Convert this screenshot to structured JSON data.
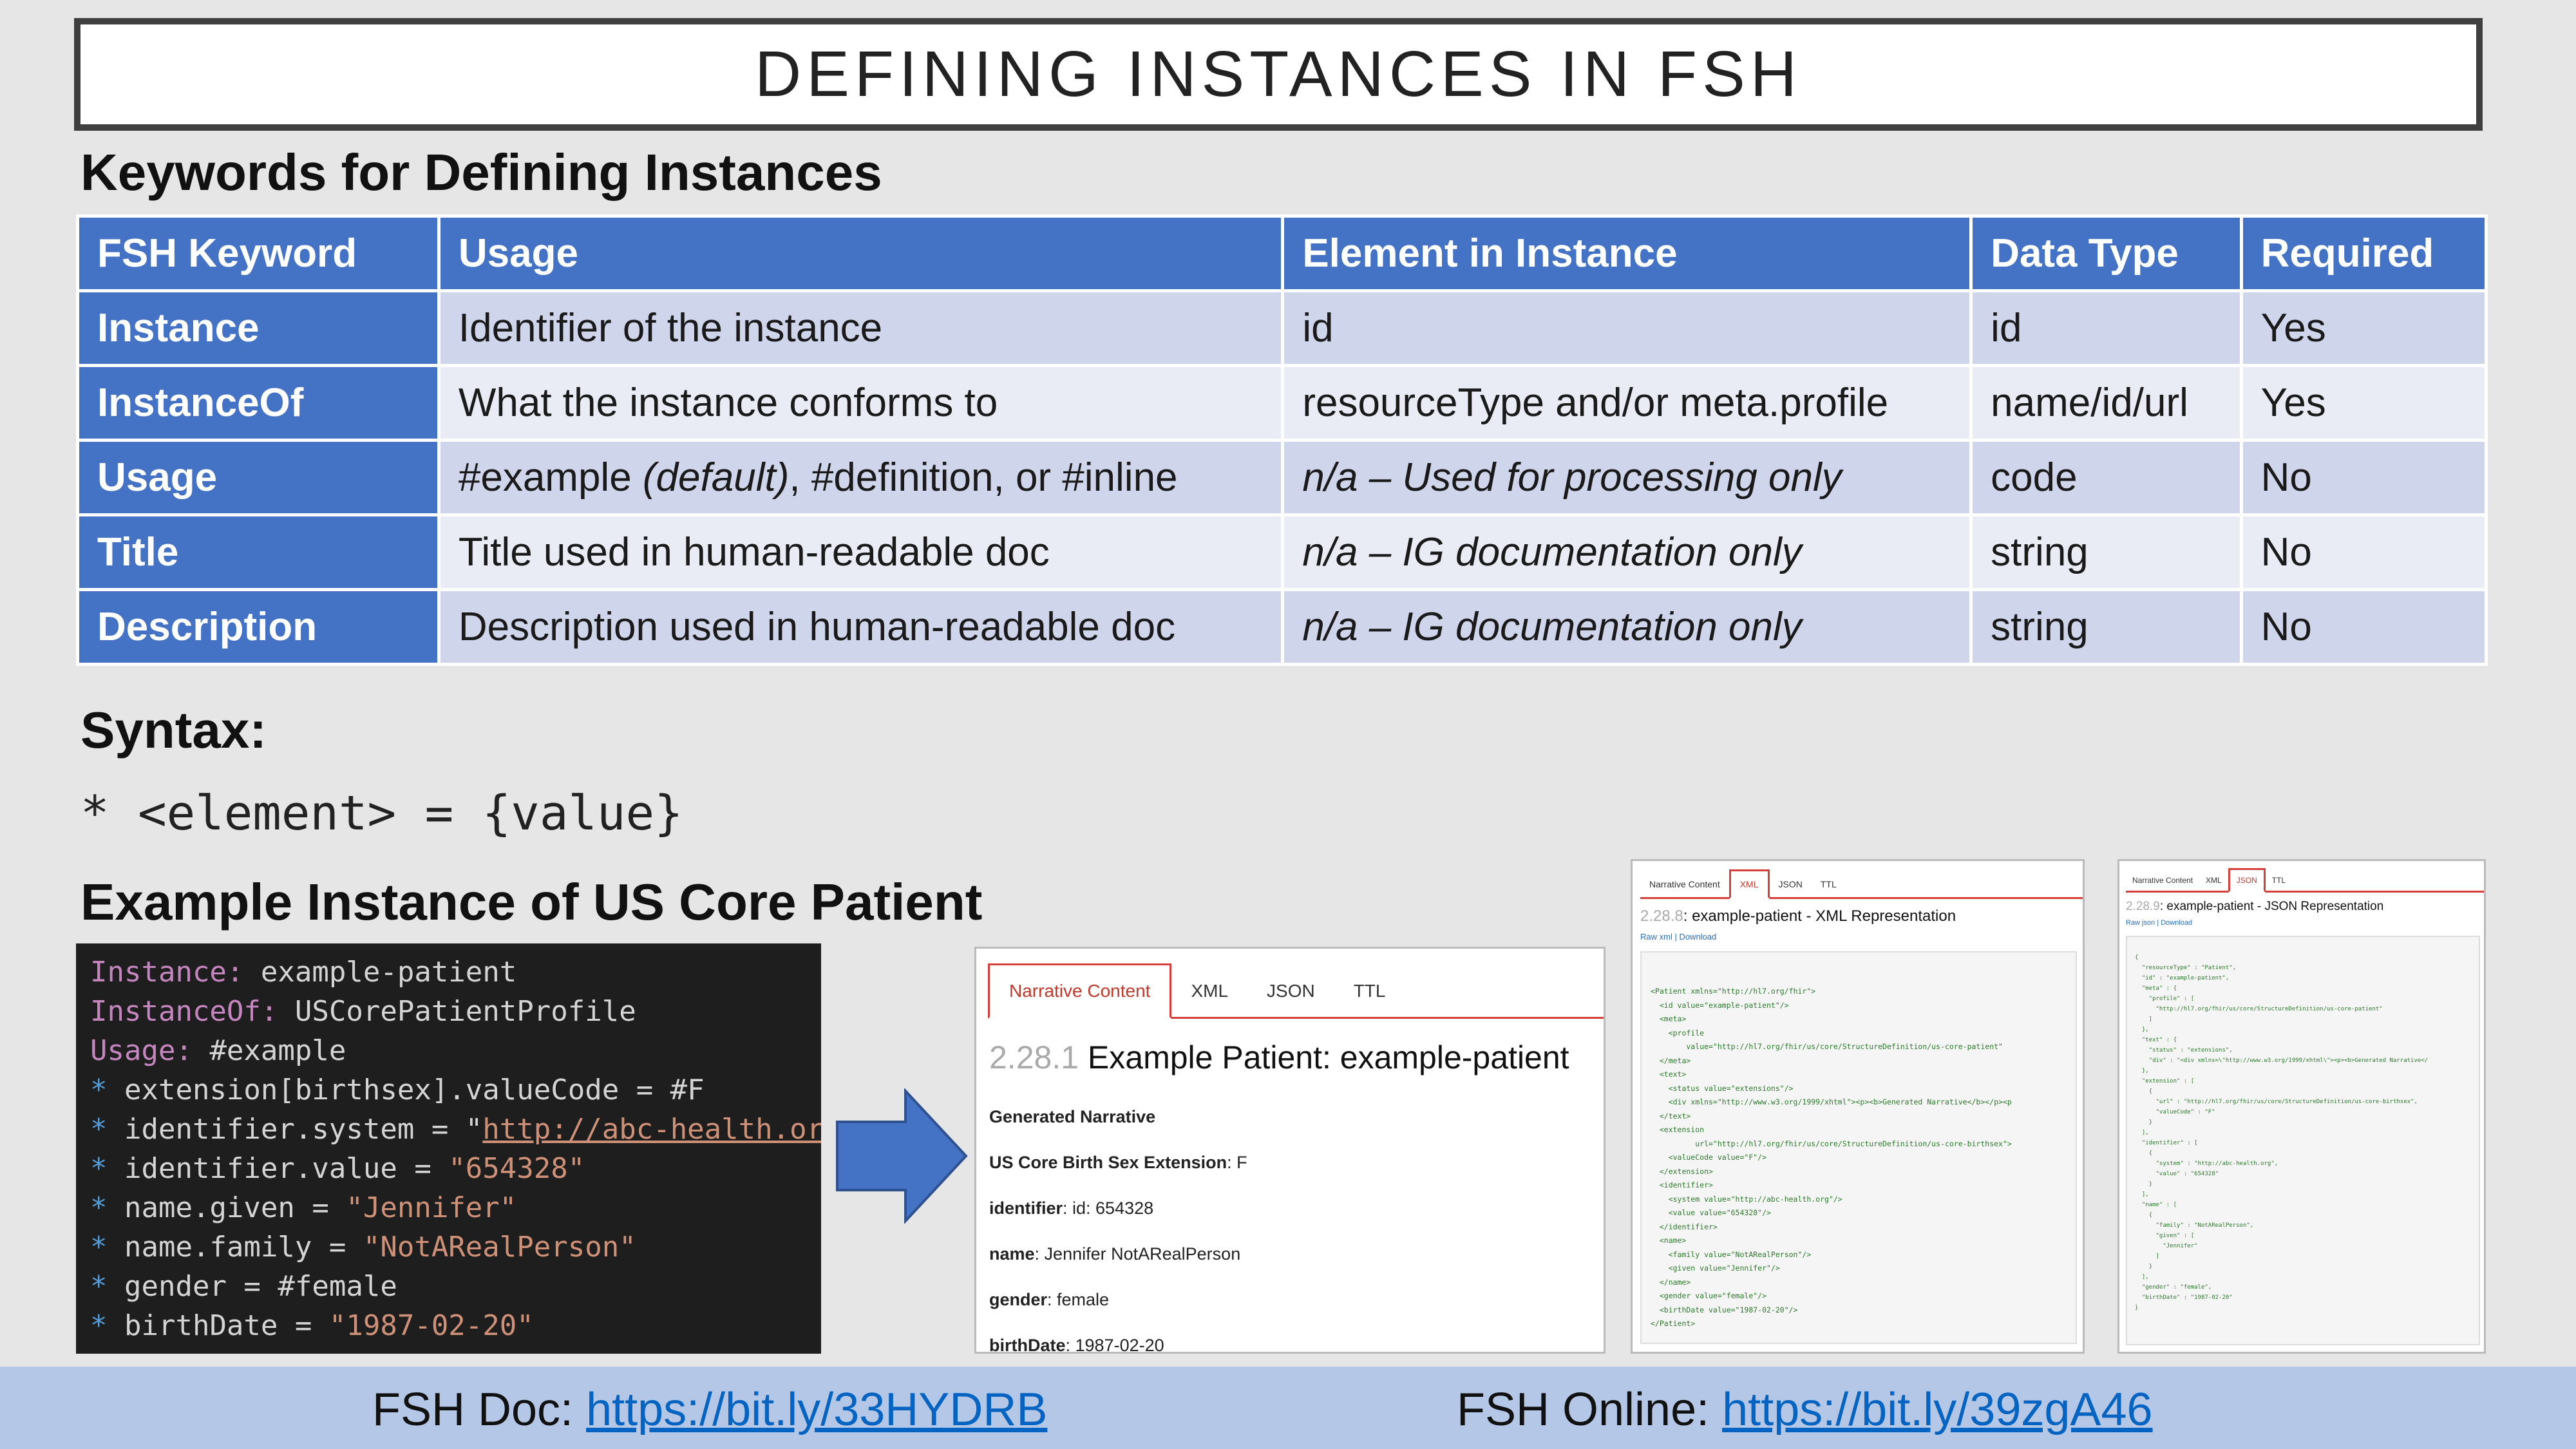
{
  "title": "DEFINING INSTANCES IN FSH",
  "keywords_heading": "Keywords for Defining Instances",
  "table": {
    "headers": [
      "FSH Keyword",
      "Usage",
      "Element in Instance",
      "Data Type",
      "Required"
    ],
    "rows": [
      {
        "keyword": "Instance",
        "usage_a": "Identifier of the instance",
        "usage_b": "",
        "usage_c": "",
        "element": "id",
        "element_italic": false,
        "type": "id",
        "required": "Yes"
      },
      {
        "keyword": "InstanceOf",
        "usage_a": "What the instance conforms to",
        "usage_b": "",
        "usage_c": "",
        "element": "resourceType and/or meta.profile",
        "element_italic": false,
        "type": "name/id/url",
        "required": "Yes"
      },
      {
        "keyword": "Usage",
        "usage_a": "#example ",
        "usage_b": "(default)",
        "usage_c": ", #definition, or #inline",
        "element": "n/a – Used for processing only",
        "element_italic": true,
        "type": "code",
        "required": "No"
      },
      {
        "keyword": "Title",
        "usage_a": "Title used in human-readable doc",
        "usage_b": "",
        "usage_c": "",
        "element": "n/a – IG documentation only",
        "element_italic": true,
        "type": "string",
        "required": "No"
      },
      {
        "keyword": "Description",
        "usage_a": "Description used in human-readable doc",
        "usage_b": "",
        "usage_c": "",
        "element": "n/a – IG documentation only",
        "element_italic": true,
        "type": "string",
        "required": "No"
      }
    ]
  },
  "syntax_heading": "Syntax:",
  "syntax_text": "* <element> = {value}",
  "example_heading": "Example Instance of US Core Patient",
  "code": {
    "l1k": "Instance:",
    "l1v": " example-patient",
    "l2k": "InstanceOf:",
    "l2v": " USCorePatientProfile",
    "l3k": "Usage:",
    "l3v": " #example",
    "l4": " extension[birthsex].valueCode = #F",
    "l5a": " identifier.system = \"",
    "l5b": "http://abc-health.org",
    "l5c": "\"",
    "l6a": " identifier.value = ",
    "l6b": "\"654328\"",
    "l7a": " name.given = ",
    "l7b": "\"Jennifer\"",
    "l8a": " name.family = ",
    "l8b": "\"NotARealPerson\"",
    "l9": " gender = #female",
    "l10a": " birthDate = ",
    "l10b": "\"1987-02-20\"",
    "star": "*"
  },
  "narrative": {
    "tabs": [
      "Narrative Content",
      "XML",
      "JSON",
      "TTL"
    ],
    "num": "2.28.1",
    "heading": "Example Patient: example-patient",
    "generated": "Generated Narrative",
    "fields": [
      {
        "label": "US Core Birth Sex Extension",
        "value": ": F"
      },
      {
        "label": "identifier",
        "value": ": id: 654328"
      },
      {
        "label": "name",
        "value": ": Jennifer NotARealPerson"
      },
      {
        "label": "gender",
        "value": ": female"
      },
      {
        "label": "birthDate",
        "value": ": 1987-02-20"
      }
    ]
  },
  "xml": {
    "tabs": [
      "Narrative Content",
      "XML",
      "JSON",
      "TTL"
    ],
    "num": "2.28.8",
    "heading": ": example-patient - XML Representation",
    "links": "Raw xml | Download",
    "lines": [
      "<Patient xmlns=\"http://hl7.org/fhir\">",
      "  <id value=\"example-patient\"/>",
      "  <meta>",
      "    <profile",
      "        value=\"http://hl7.org/fhir/us/core/StructureDefinition/us-core-patient\"",
      "  </meta>",
      "  <text>",
      "    <status value=\"extensions\"/>",
      "    <div xmlns=\"http://www.w3.org/1999/xhtml\"><p><b>Generated Narrative</b></p><p",
      "  </text>",
      "  <extension",
      "          url=\"http://hl7.org/fhir/us/core/StructureDefinition/us-core-birthsex\">",
      "    <valueCode value=\"F\"/>",
      "  </extension>",
      "  <identifier>",
      "    <system value=\"http://abc-health.org\"/>",
      "    <value value=\"654328\"/>",
      "  </identifier>",
      "  <name>",
      "    <family value=\"NotARealPerson\"/>",
      "    <given value=\"Jennifer\"/>",
      "  </name>",
      "  <gender value=\"female\"/>",
      "  <birthDate value=\"1987-02-20\"/>",
      "</Patient>"
    ]
  },
  "json": {
    "tabs": [
      "Narrative Content",
      "XML",
      "JSON",
      "TTL"
    ],
    "num": "2.28.9",
    "heading": ": example-patient - JSON Representation",
    "links": "Raw json | Download",
    "lines": [
      "{",
      "  \"resourceType\" : \"Patient\",",
      "  \"id\" : \"example-patient\",",
      "  \"meta\" : {",
      "    \"profile\" : [",
      "      \"http://hl7.org/fhir/us/core/StructureDefinition/us-core-patient\"",
      "    ]",
      "  },",
      "  \"text\" : {",
      "    \"status\" : \"extensions\",",
      "    \"div\" : \"<div xmlns=\\\"http://www.w3.org/1999/xhtml\\\"><p><b>Generated Narrative</",
      "  },",
      "  \"extension\" : [",
      "    {",
      "      \"url\" : \"http://hl7.org/fhir/us/core/StructureDefinition/us-core-birthsex\",",
      "      \"valueCode\" : \"F\"",
      "    }",
      "  ],",
      "  \"identifier\" : [",
      "    {",
      "      \"system\" : \"http://abc-health.org\",",
      "      \"value\" : \"654328\"",
      "    }",
      "  ],",
      "  \"name\" : [",
      "    {",
      "      \"family\" : \"NotARealPerson\",",
      "      \"given\" : [",
      "        \"Jennifer\"",
      "      ]",
      "    }",
      "  ],",
      "  \"gender\" : \"female\",",
      "  \"birthDate\" : \"1987-02-20\"",
      "}"
    ]
  },
  "footer": {
    "doc_label": "FSH Doc: ",
    "doc_link": "https://bit.ly/33HYDRB",
    "online_label": "FSH Online: ",
    "online_link": "https://bit.ly/39zgA46"
  }
}
